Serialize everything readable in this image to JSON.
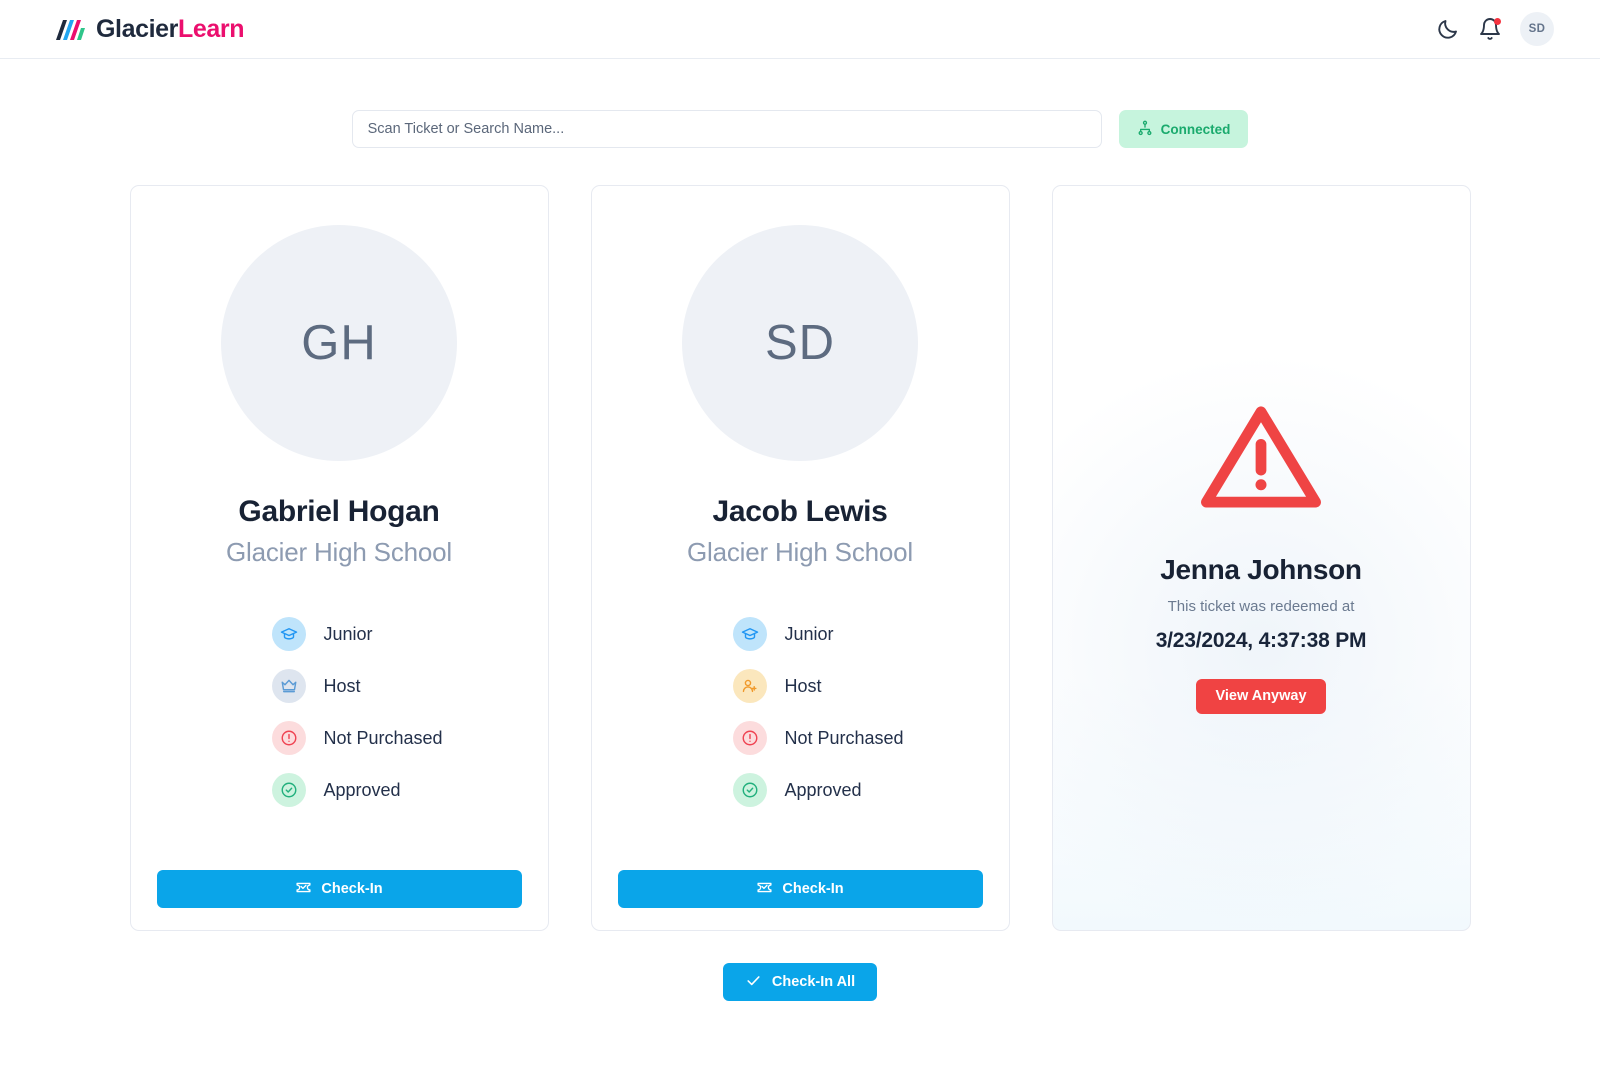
{
  "header": {
    "brand_part1": "Glacier",
    "brand_part2": "Learn",
    "brand_color_1": "#1f2a3d",
    "brand_color_2": "#eb0f6e",
    "theme_toggle_icon": "moon-icon",
    "notifications_icon": "bell-icon",
    "has_notification": true,
    "avatar_initials": "SD"
  },
  "search": {
    "placeholder": "Scan Ticket or Search Name...",
    "value": "",
    "status_label": "Connected",
    "status_icon": "network-icon",
    "status_color": "#1aaa6d",
    "status_bg": "#c6f4dd"
  },
  "cards": [
    {
      "initials": "GH",
      "name": "Gabriel Hogan",
      "org": "Glacier High School",
      "attributes": [
        {
          "icon": "graduation-cap-icon",
          "label": "Junior",
          "fg": "#2196f3",
          "bg": "#bfe4fb"
        },
        {
          "icon": "crown-icon",
          "label": "Host",
          "fg": "#5b9bd5",
          "bg": "#dee5ef"
        },
        {
          "icon": "alert-circle-icon",
          "label": "Not Purchased",
          "fg": "#ef4352",
          "bg": "#fcdcdd"
        },
        {
          "icon": "check-circle-icon",
          "label": "Approved",
          "fg": "#22b07d",
          "bg": "#cdf3df"
        }
      ],
      "action_label": "Check-In",
      "action_icon": "ticket-check-icon"
    },
    {
      "initials": "SD",
      "name": "Jacob Lewis",
      "org": "Glacier High School",
      "attributes": [
        {
          "icon": "graduation-cap-icon",
          "label": "Junior",
          "fg": "#2196f3",
          "bg": "#bfe4fb"
        },
        {
          "icon": "user-plus-icon",
          "label": "Host",
          "fg": "#f0992a",
          "bg": "#fbe7bd"
        },
        {
          "icon": "alert-circle-icon",
          "label": "Not Purchased",
          "fg": "#ef4352",
          "bg": "#fcdcdd"
        },
        {
          "icon": "check-circle-icon",
          "label": "Approved",
          "fg": "#22b07d",
          "bg": "#cdf3df"
        }
      ],
      "action_label": "Check-In",
      "action_icon": "ticket-check-icon"
    }
  ],
  "redeemed_card": {
    "warning_icon": "alert-triangle-icon",
    "warning_color": "#ef4444",
    "name": "Jenna Johnson",
    "message": "This ticket was redeemed at",
    "timestamp": "3/23/2024, 4:37:38 PM",
    "action_label": "View Anyway",
    "action_color": "#f04343"
  },
  "footer": {
    "checkin_all_label": "Check-In All",
    "checkin_all_icon": "check-icon",
    "accent_color": "#0aa5e9"
  }
}
